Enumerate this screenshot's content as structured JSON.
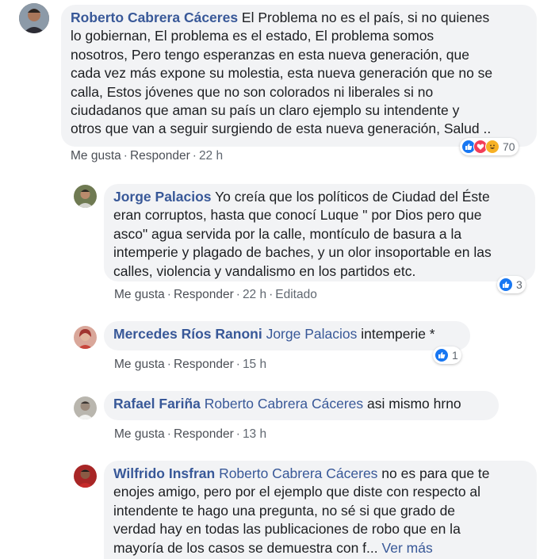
{
  "comments": [
    {
      "author": "Roberto Cabrera Cáceres",
      "lines": [
        " El Problema no es el país, si no quienes",
        "lo gobiernan, El problema es el estado, El problema somos",
        "nosotros, Pero tengo esperanzas en esta nueva generación, que",
        "cada vez más expone su molestia, esta nueva generación que no se",
        "calla, Estos jóvenes que no son colorados ni liberales si no",
        "ciudadanos que aman su país un claro ejemplo su intendente y",
        "otros que van a seguir surgiendo de esta nueva generación, Salud .."
      ],
      "actions": {
        "like": "Me gusta",
        "reply": "Responder",
        "time": "22 h"
      },
      "reactions": {
        "icons": [
          "like-icon",
          "love-icon",
          "haha-icon"
        ],
        "count": "70"
      }
    },
    {
      "author": "Jorge Palacios",
      "lines": [
        " Yo creía que los políticos de Ciudad del Éste",
        "eran corruptos, hasta que conocí Luque \" por Dios pero que",
        "asco\" agua servida por la calle, montículo de basura a la",
        "intemperie y plagado de baches, y un olor insoportable en las",
        "calles, violencia y vandalismo en los partidos etc."
      ],
      "actions": {
        "like": "Me gusta",
        "reply": "Responder",
        "time": "22 h",
        "edited": "Editado"
      },
      "reactions": {
        "icons": [
          "like-icon"
        ],
        "count": "3"
      }
    },
    {
      "author": "Mercedes Ríos Ranoni",
      "mention": "Jorge Palacios",
      "text": " intemperie *",
      "actions": {
        "like": "Me gusta",
        "reply": "Responder",
        "time": "15 h"
      },
      "reactions": {
        "icons": [
          "like-icon"
        ],
        "count": "1"
      }
    },
    {
      "author": "Rafael Fariña",
      "mention": "Roberto Cabrera Cáceres",
      "text": " asi mismo hrno",
      "actions": {
        "like": "Me gusta",
        "reply": "Responder",
        "time": "13 h"
      }
    },
    {
      "author": "Wilfrido Insfran",
      "mention": "Roberto Cabrera Cáceres",
      "lines": [
        " no es para que te",
        "enojes amigo, pero por el ejemplo que diste con respecto al",
        "intendente te hago una pregunta, no sé si que grado de",
        "verdad hay en todas las publicaciones de robo que en la",
        "mayoría de los casos se demuestra con f... "
      ],
      "see_more": "Ver más"
    }
  ],
  "colors": {
    "link": "#385898",
    "bubble": "#f2f3f5",
    "meta": "#606770",
    "like": "#1877f2",
    "love": "#f33e58",
    "haha": "#f7b125"
  }
}
